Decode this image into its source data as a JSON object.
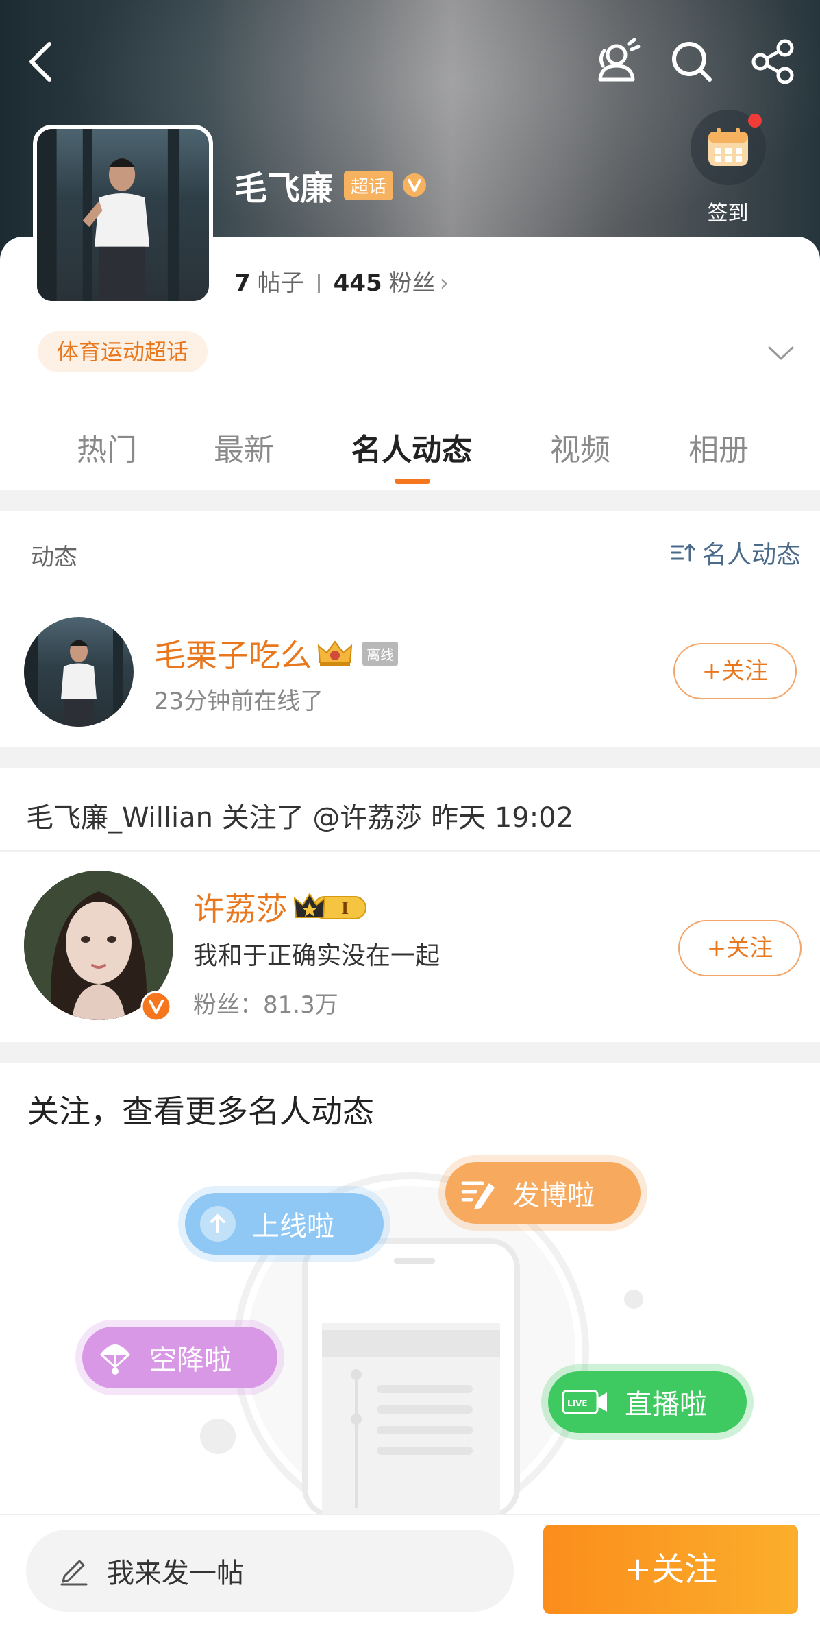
{
  "header": {
    "checkin_label": "签到"
  },
  "profile": {
    "name": "毛飞廉",
    "chaohua_badge": "超话",
    "posts_count": "7",
    "posts_label": "帖子",
    "fans_count": "445",
    "fans_label": "粉丝",
    "category_tag": "体育运动超话"
  },
  "tabs": [
    {
      "label": "热门",
      "active": false
    },
    {
      "label": "最新",
      "active": false
    },
    {
      "label": "名人动态",
      "active": true
    },
    {
      "label": "视频",
      "active": false
    },
    {
      "label": "相册",
      "active": false
    }
  ],
  "activity": {
    "section_title": "动态",
    "sort_label": "名人动态",
    "user": {
      "name": "毛栗子吃么",
      "status_badge": "离线",
      "status_text": "23分钟前在线了",
      "follow_label": "+关注"
    }
  },
  "follow_event": {
    "text": "毛飞廉_Willian 关注了 @许荔莎 昨天 19:02",
    "user": {
      "name": "许荔莎",
      "level": "I",
      "bio": "我和于正确实没在一起",
      "fans": "粉丝：81.3万",
      "follow_label": "+关注"
    }
  },
  "promo": {
    "title": "关注，查看更多名人动态",
    "pills": {
      "online": "上线啦",
      "post": "发博啦",
      "land": "空降啦",
      "live": "直播啦",
      "live_icon_text": "LIVE"
    }
  },
  "bottom": {
    "compose_placeholder": "我来发一帖",
    "follow_label": "+关注"
  },
  "colors": {
    "accent": "#e8771d",
    "follow_gradient_start": "#fb8d1c",
    "follow_gradient_end": "#fbae2c",
    "tag_bg": "#fdf1e6",
    "link_blue": "#4a6a8a"
  }
}
